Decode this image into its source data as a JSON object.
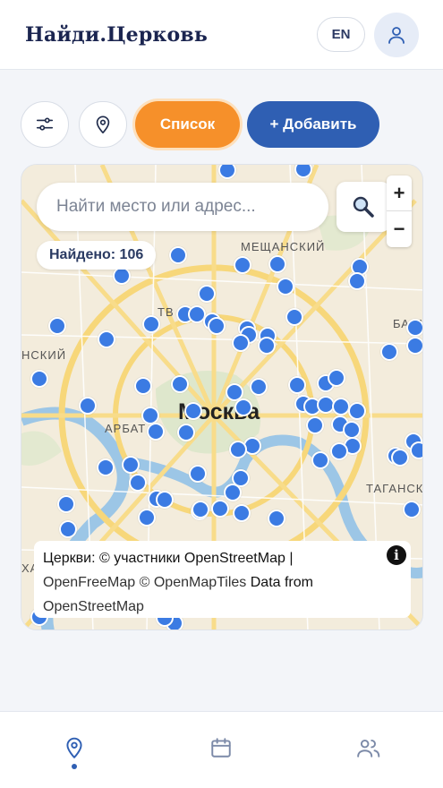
{
  "header": {
    "logo": "Найди.Церковь",
    "lang": "EN",
    "user_icon": "user-icon"
  },
  "toolbar": {
    "filter_icon": "sliders-icon",
    "location_icon": "map-pin-icon",
    "list_label": "Список",
    "add_label": "+ Добавить"
  },
  "map": {
    "search_placeholder": "Найти место или адрес...",
    "search_icon": "magnifier-icon",
    "zoom_in": "+",
    "zoom_out": "−",
    "found": "Найдено: 106",
    "city": "Москва",
    "districts": [
      "МЕЩАНСКИЙ",
      "ТВ",
      "БАСМ",
      "АРБАТ",
      "ТАГАНСКИ",
      "НСКИЙ",
      "ХА"
    ],
    "attribution_line1": "Церкви: © участники OpenStreetMap |",
    "attribution_line2a": "OpenFreeMap © OpenMapTiles",
    "attribution_line2b": " Data from",
    "attribution_line3": "OpenStreetMap",
    "info": "i",
    "marker_color": "#3b7be3"
  },
  "nav": {
    "items": [
      "map-pin-icon",
      "calendar-icon",
      "users-icon"
    ],
    "active": 0
  }
}
